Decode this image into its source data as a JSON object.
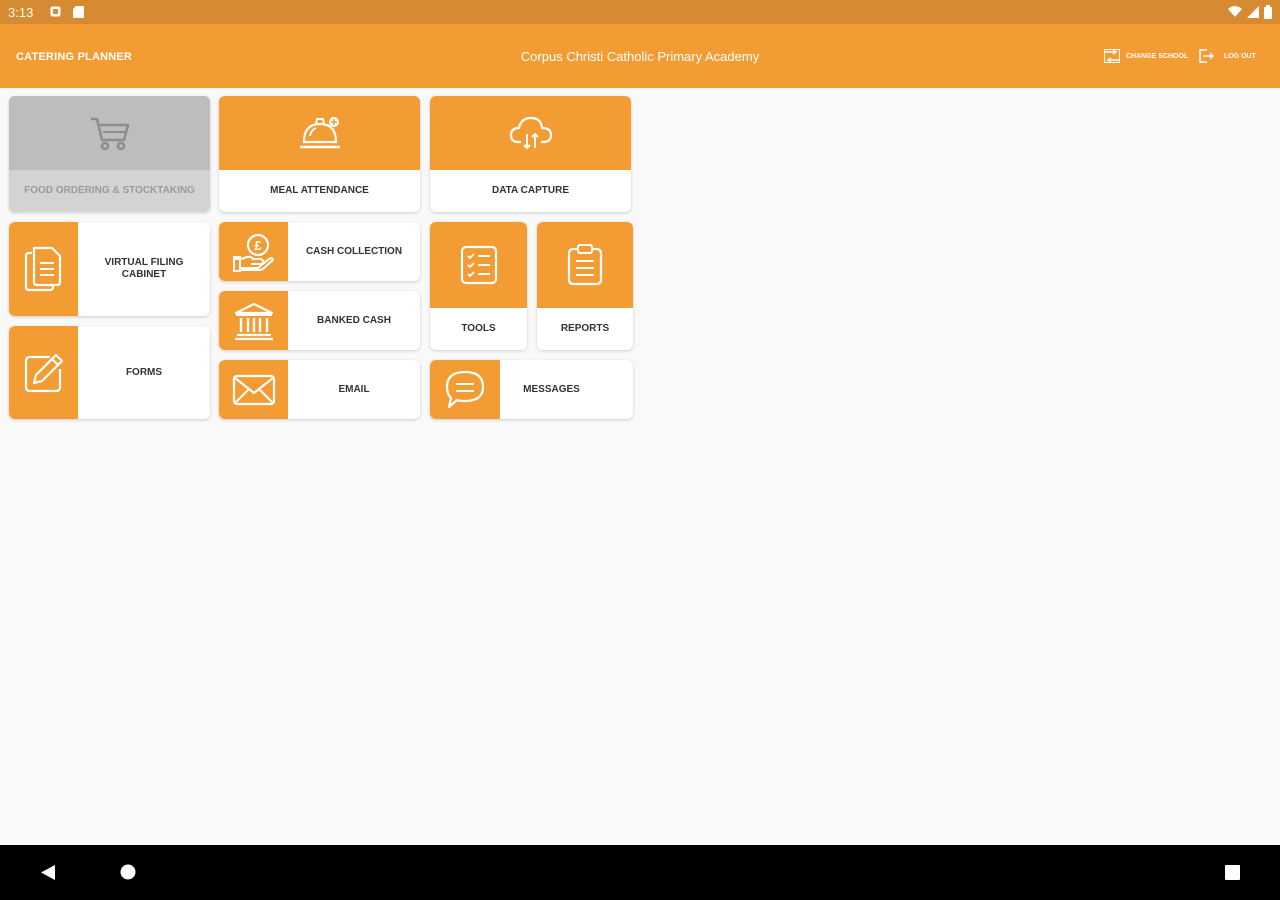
{
  "status_bar": {
    "time": "3:13"
  },
  "app_bar": {
    "app_name": "CATERING PLANNER",
    "school_name": "Corpus Christi Catholic Primary Academy",
    "change_school_label": "CHANGE SCHOOL",
    "log_out_label": "LOG OUT"
  },
  "tiles": {
    "food_ordering": {
      "label": "FOOD ORDERING & STOCKTAKING",
      "icon": "shopping-cart-icon"
    },
    "meal_attendance": {
      "label": "MEAL ATTENDANCE",
      "icon": "service-bell-icon"
    },
    "data_capture": {
      "label": "DATA CAPTURE",
      "icon": "cloud-sync-icon"
    },
    "virtual_filing": {
      "label": "VIRTUAL FILING CABINET",
      "icon": "documents-icon"
    },
    "cash_collection": {
      "label": "CASH COLLECTION",
      "icon": "hand-coin-icon"
    },
    "tools": {
      "label": "TOOLS",
      "icon": "checklist-icon"
    },
    "reports": {
      "label": "REPORTS",
      "icon": "clipboard-icon"
    },
    "banked_cash": {
      "label": "BANKED CASH",
      "icon": "bank-icon"
    },
    "forms": {
      "label": "FORMS",
      "icon": "edit-icon"
    },
    "email": {
      "label": "EMAIL",
      "icon": "envelope-icon"
    },
    "messages": {
      "label": "MESSAGES",
      "icon": "chat-bubble-icon"
    }
  },
  "colors": {
    "accent": "#f39c34",
    "status_bar": "#d68b33",
    "disabled": "#d3d3d3"
  }
}
